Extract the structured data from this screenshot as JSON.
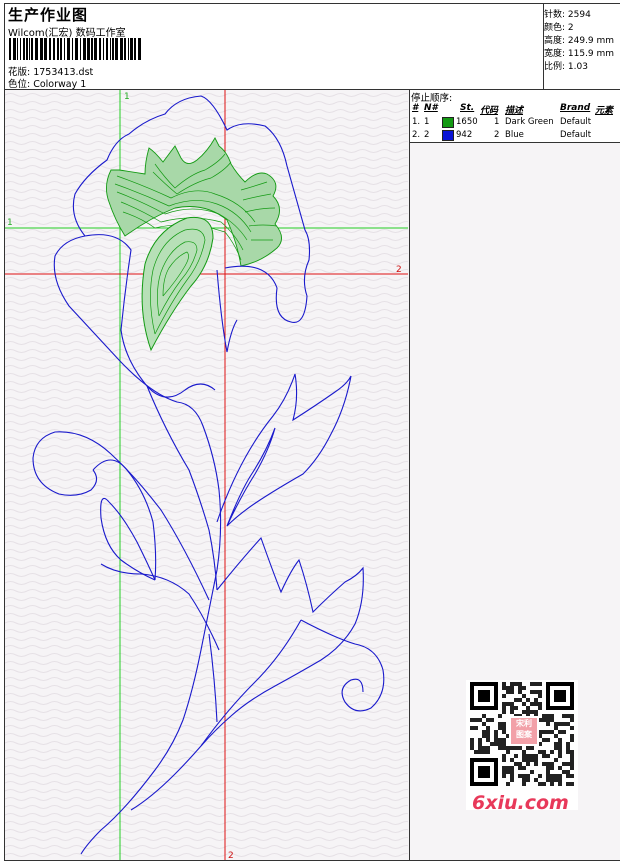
{
  "header": {
    "title": "生产作业图",
    "subtitle": "Wilcom(汇宏) 数码工作室",
    "design_line": "花版: 1753413.dst",
    "colorway_line": "色位: Colorway 1"
  },
  "stats": {
    "stitches": "针数: 2594",
    "colors": "颜色: 2",
    "height": "高度: 249.9 mm",
    "width": "宽度: 115.9 mm",
    "scale": "比例: 1.03"
  },
  "stop_sequence": {
    "title": "停止顺序:",
    "columns": {
      "num": "#",
      "needle": "N#",
      "stitches": "St.",
      "code": "代码",
      "description": "描述",
      "brand": "Brand",
      "element": "元素"
    },
    "rows": [
      {
        "num": "1.",
        "needle": "1",
        "color": "#139a13",
        "stitches": "1650",
        "code": "1",
        "description": "Dark Green",
        "brand": "Default"
      },
      {
        "num": "2.",
        "needle": "2",
        "color": "#0a14d6",
        "stitches": "942",
        "code": "2",
        "description": "Blue",
        "brand": "Default"
      }
    ]
  },
  "guides": {
    "green_v_label": "1",
    "green_h_label": "1",
    "red_h_label": "2",
    "red_v_label": "2"
  },
  "watermark": {
    "site": "6xiu.com",
    "stamp": "宋利\n图案"
  },
  "colors": {
    "guide_green": "#22cc22",
    "guide_red": "#dd1111",
    "outline_blue": "#1a1acc",
    "fill_green": "#139a13"
  }
}
